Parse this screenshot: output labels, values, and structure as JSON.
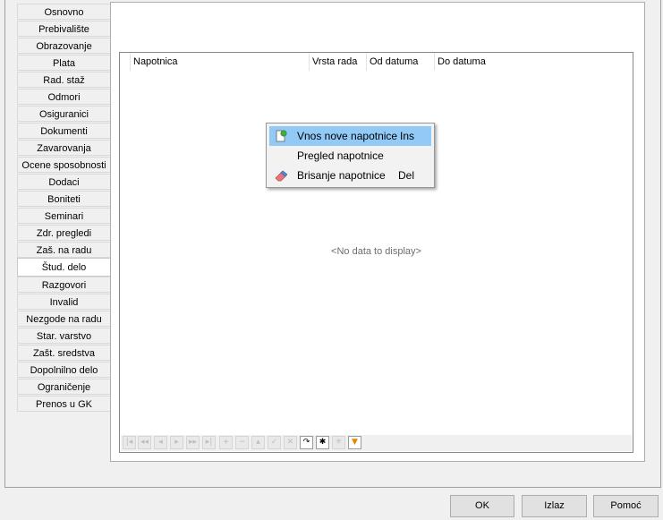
{
  "tabs": [
    {
      "label": "Osnovno"
    },
    {
      "label": "Prebivalište"
    },
    {
      "label": "Obrazovanje"
    },
    {
      "label": "Plata"
    },
    {
      "label": "Rad. staž"
    },
    {
      "label": "Odmori"
    },
    {
      "label": "Osiguranici"
    },
    {
      "label": "Dokumenti"
    },
    {
      "label": "Zavarovanja"
    },
    {
      "label": "Ocene sposobnosti"
    },
    {
      "label": "Dodaci"
    },
    {
      "label": "Boniteti"
    },
    {
      "label": "Seminari"
    },
    {
      "label": "Zdr. pregledi"
    },
    {
      "label": "Zaš. na radu"
    },
    {
      "label": "Štud. delo"
    },
    {
      "label": "Razgovori"
    },
    {
      "label": "Invalid"
    },
    {
      "label": "Nezgode na radu"
    },
    {
      "label": "Star. varstvo"
    },
    {
      "label": "Zašt. sredstva"
    },
    {
      "label": "Dopolnilno delo"
    },
    {
      "label": "Ograničenje"
    },
    {
      "label": "Prenos u GK"
    }
  ],
  "active_tab": "Štud. delo",
  "grid": {
    "columns": [
      "Napotnica",
      "Vrsta rada",
      "Od datuma",
      "Do datuma"
    ],
    "empty_text": "<No data to display>"
  },
  "context_menu": {
    "items": [
      {
        "label": "Vnos nove napotnice",
        "shortcut": "Ins",
        "icon": "new-document-icon"
      },
      {
        "label": "Pregled napotnice",
        "shortcut": "",
        "icon": ""
      },
      {
        "label": "Brisanje napotnice",
        "shortcut": "Del",
        "icon": "eraser-icon"
      }
    ]
  },
  "navigator": {
    "buttons": [
      "first-icon",
      "prev-page-icon",
      "prev-icon",
      "next-icon",
      "next-page-icon",
      "last-icon",
      "append-icon",
      "delete-icon",
      "edit-icon",
      "post-icon",
      "cancel-icon",
      "refresh-icon",
      "bookmark-icon",
      "goto-bookmark-icon",
      "filter-icon"
    ]
  },
  "footer": {
    "ok": "OK",
    "exit": "Izlaz",
    "help": "Pomoć"
  },
  "colors": {
    "menu_highlight": "#91c9f7",
    "window_bg": "#f0f0f0"
  }
}
